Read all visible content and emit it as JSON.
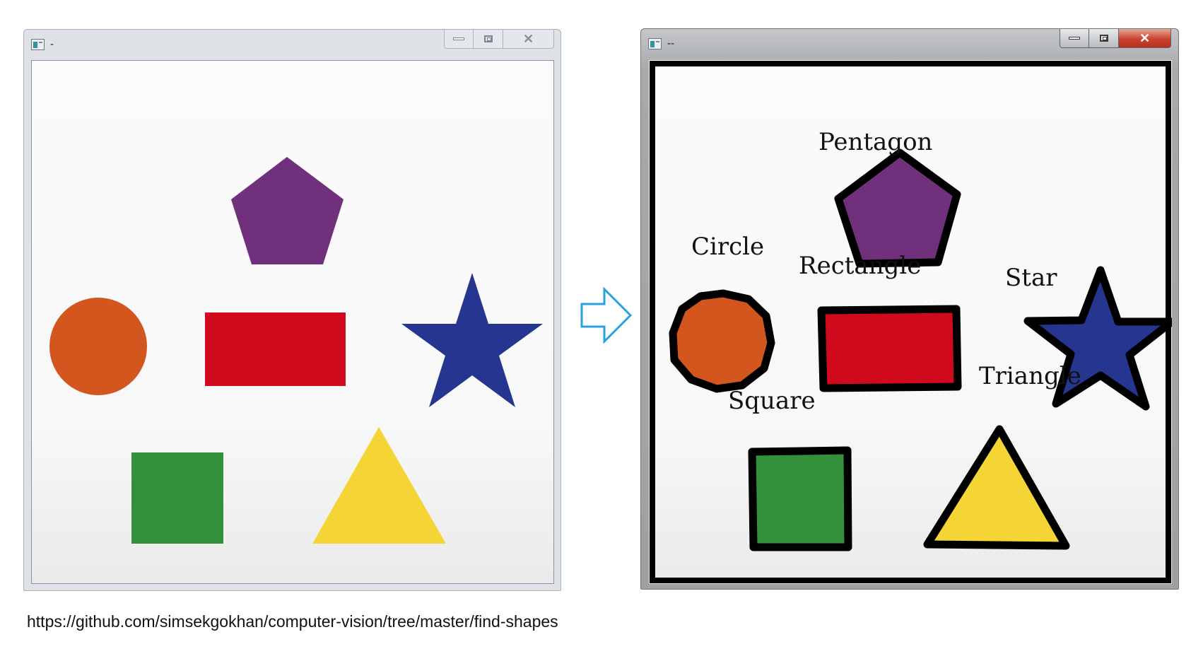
{
  "left_window": {
    "title": "-",
    "shapes": [
      "pentagon",
      "circle",
      "rectangle",
      "star",
      "square",
      "triangle"
    ]
  },
  "right_window": {
    "title": "--",
    "labels": {
      "pentagon": "Pentagon",
      "circle": "Circle",
      "rectangle": "Rectangle",
      "star": "Star",
      "square": "Square",
      "triangle": "Triangle"
    }
  },
  "colors": {
    "pentagon": "#70307c",
    "circle": "#d4561f",
    "rectangle": "#d0091c",
    "star": "#253590",
    "square": "#33903b",
    "triangle": "#f5d536",
    "contour": "#000000",
    "arrow": "#29a3dd"
  },
  "arrow": {
    "icon": "right-arrow-icon"
  },
  "source_url": "https://github.com/simsekgokhan/computer-vision/tree/master/find-shapes"
}
